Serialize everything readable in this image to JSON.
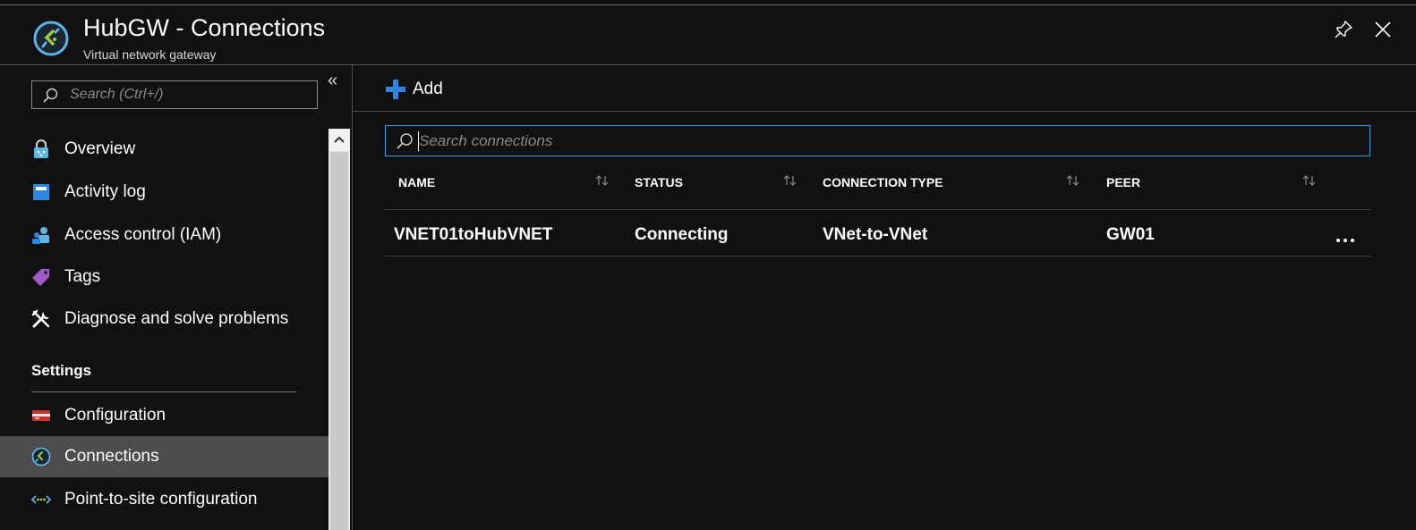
{
  "header": {
    "title": "HubGW - Connections",
    "subtitle": "Virtual network gateway"
  },
  "sidebar": {
    "search_placeholder": "Search (Ctrl+/)",
    "items": [
      {
        "label": "Overview",
        "icon": "overview-icon"
      },
      {
        "label": "Activity log",
        "icon": "activity-log-icon"
      },
      {
        "label": "Access control (IAM)",
        "icon": "access-control-icon"
      },
      {
        "label": "Tags",
        "icon": "tag-icon"
      },
      {
        "label": "Diagnose and solve problems",
        "icon": "wrench-icon"
      }
    ],
    "section_heading": "Settings",
    "settings_items": [
      {
        "label": "Configuration",
        "icon": "configuration-icon"
      },
      {
        "label": "Connections",
        "icon": "gateway-icon",
        "active": true
      },
      {
        "label": "Point-to-site configuration",
        "icon": "point-to-site-icon"
      }
    ]
  },
  "toolbar": {
    "add_label": "Add"
  },
  "connections": {
    "search_placeholder": "Search connections",
    "columns": [
      "NAME",
      "STATUS",
      "CONNECTION TYPE",
      "PEER"
    ],
    "rows": [
      {
        "name": "VNET01toHubVNET",
        "status": "Connecting",
        "type": "VNet-to-VNet",
        "peer": "GW01"
      }
    ]
  },
  "colors": {
    "background": "#111111",
    "accent": "#3b9bd8",
    "active_item": "#4d4d4d",
    "add_plus": "#2f86e0"
  }
}
